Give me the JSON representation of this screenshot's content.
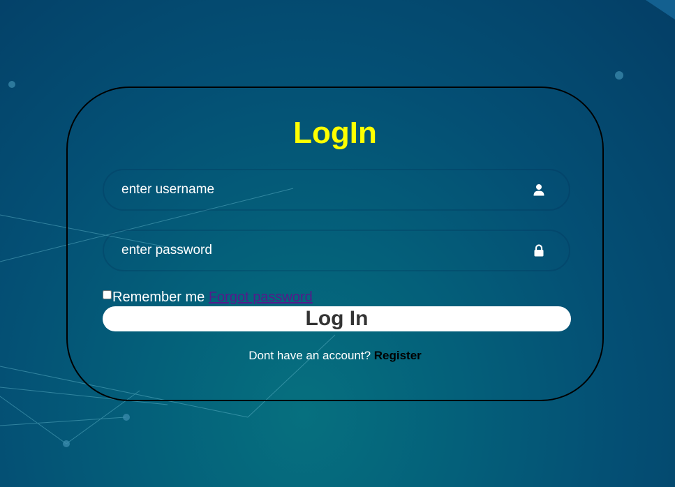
{
  "login": {
    "title": "LogIn",
    "username_placeholder": "enter username",
    "password_placeholder": "enter password",
    "remember_label": "Remember me",
    "remember_checked": false,
    "forgot_link": "Forgot password",
    "login_button": "Log In",
    "register_prompt": "Dont have an account? ",
    "register_link": "Register"
  },
  "icons": {
    "username": "user-icon",
    "password": "lock-icon"
  },
  "colors": {
    "title": "#ffff00",
    "forgot_link": "#551a8b",
    "register_link": "#000000",
    "button_bg": "#ffffff",
    "button_text": "#333333"
  }
}
